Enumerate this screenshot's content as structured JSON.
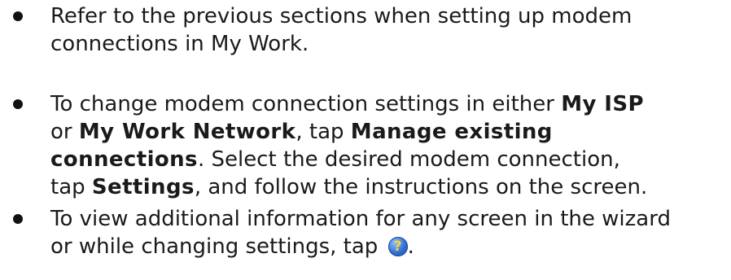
{
  "bullets": [
    {
      "lines": [
        "Refer to the previous sections when setting up modem",
        "connections in My Work."
      ]
    },
    {
      "lines": [
        {
          "pre": "To change modem connection settings in either ",
          "bold": "My ISP",
          "post": ""
        },
        {
          "pre": "or ",
          "bold": "My Work Network",
          "post": ", tap ",
          "bold2": "Manage existing"
        },
        {
          "bold": "connections",
          "post": ". Select the desired modem connection,"
        },
        {
          "pre": "tap ",
          "bold": "Settings",
          "post": ", and follow the instructions on the screen."
        }
      ]
    },
    {
      "lines": [
        "To view additional information for any screen in the wizard",
        {
          "pre": "or while changing settings, tap ",
          "post": "."
        }
      ],
      "icon": "help-icon"
    }
  ],
  "colors": {
    "text": "#1a1a1a",
    "help_icon_fill": "#2f6fd0",
    "help_icon_glyph": "#ffd43a"
  }
}
